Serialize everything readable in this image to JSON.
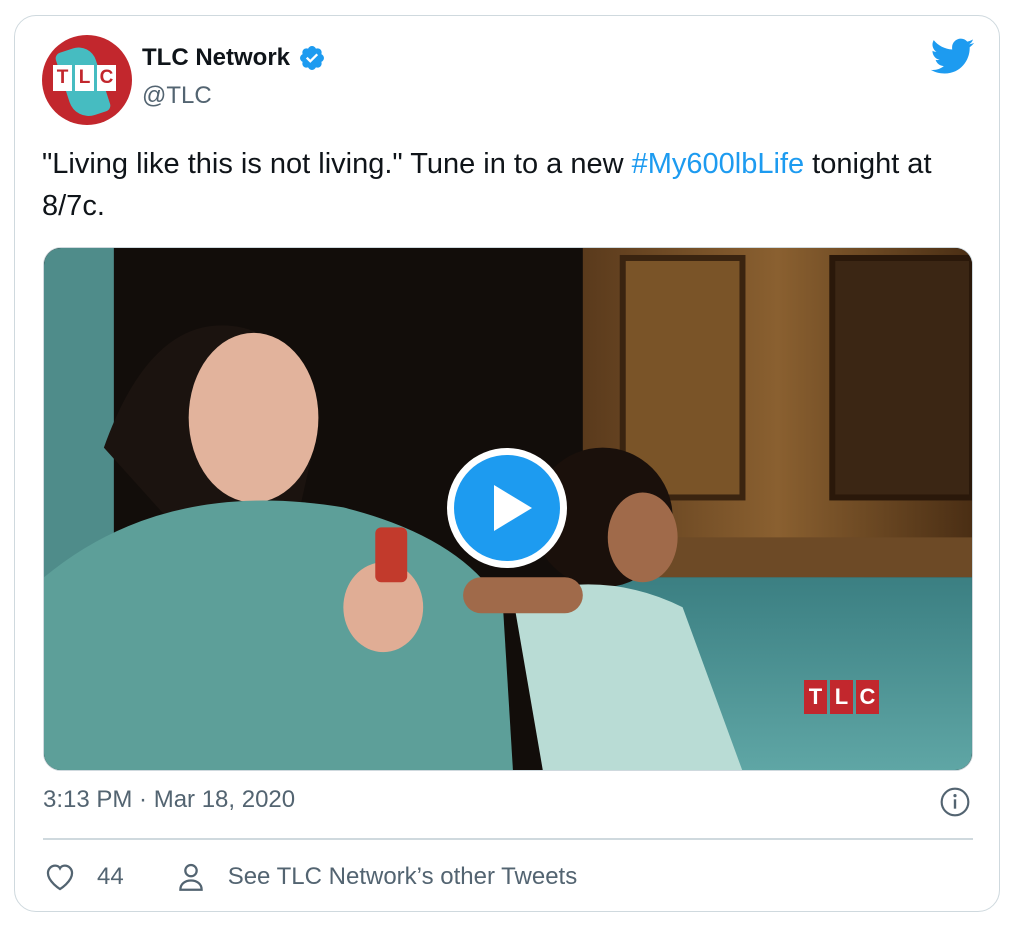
{
  "author": {
    "name": "TLC Network",
    "handle": "@TLC",
    "avatar_logo": [
      "T",
      "L",
      "C"
    ],
    "verified": true
  },
  "tweet": {
    "text_before": "\"Living like this is not living.\" Tune in to a new ",
    "hashtag": "#My600lbLife",
    "text_after": " tonight at 8/7c."
  },
  "media": {
    "type": "video",
    "watermark": [
      "T",
      "L",
      "C"
    ]
  },
  "meta": {
    "timestamp": "3:13 PM · Mar 18, 2020"
  },
  "actions": {
    "like_count": "44",
    "profile_link": "See TLC Network’s other Tweets"
  },
  "icons": {
    "brand": "twitter-bird-icon",
    "verified": "verified-badge-icon",
    "play": "play-icon",
    "info": "info-icon",
    "like": "heart-icon",
    "profile": "person-icon"
  },
  "colors": {
    "link": "#1d9bf0",
    "text": "#0f1419",
    "secondary": "#536471",
    "brand_red": "#c2272d",
    "brand_teal": "#3fc4c9"
  }
}
